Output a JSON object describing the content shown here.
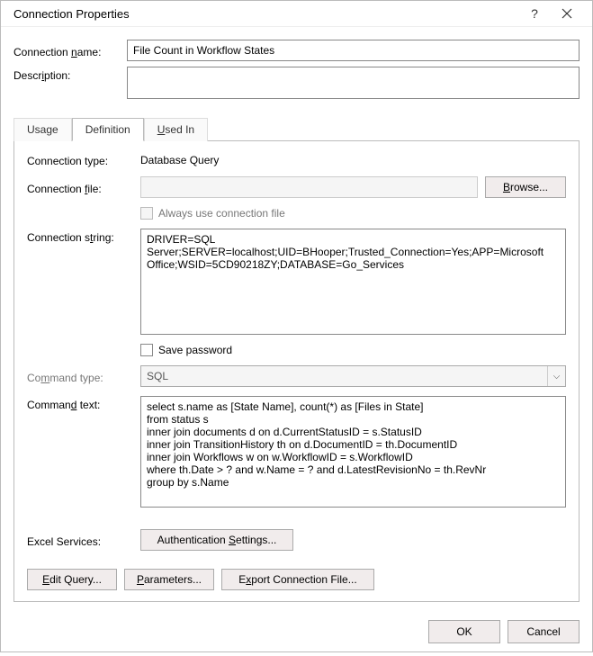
{
  "title": "Connection Properties",
  "labels": {
    "connection_name": "Connection name:",
    "description": "Description:",
    "connection_type": "Connection type:",
    "connection_file": "Connection file:",
    "connection_string": "Connection string:",
    "command_type": "Command type:",
    "command_text": "Command text:",
    "excel_services": "Excel Services:"
  },
  "fields": {
    "connection_name": "File Count in Workflow States",
    "description": "",
    "connection_type": "Database Query",
    "connection_file": "",
    "always_use": "Always use connection file",
    "save_password": "Save password",
    "command_type": "SQL",
    "connection_string": "DRIVER=SQL Server;SERVER=localhost;UID=BHooper;Trusted_Connection=Yes;APP=Microsoft Office;WSID=5CD90218ZY;DATABASE=Go_Services",
    "command_text": "select s.name as [State Name], count(*) as [Files in State]\nfrom status s\ninner join documents d on d.CurrentStatusID = s.StatusID\ninner join TransitionHistory th on d.DocumentID = th.DocumentID\ninner join Workflows w on w.WorkflowID = s.WorkflowID\nwhere th.Date > ? and w.Name = ? and d.LatestRevisionNo = th.RevNr\ngroup by s.Name"
  },
  "tabs": {
    "usage": "Usage",
    "definition": "Definition",
    "used_in": "Used In"
  },
  "buttons": {
    "browse": "Browse...",
    "auth_settings": "Authentication Settings...",
    "edit_query": "Edit Query...",
    "parameters": "Parameters...",
    "export_conn": "Export Connection File...",
    "ok": "OK",
    "cancel": "Cancel"
  }
}
